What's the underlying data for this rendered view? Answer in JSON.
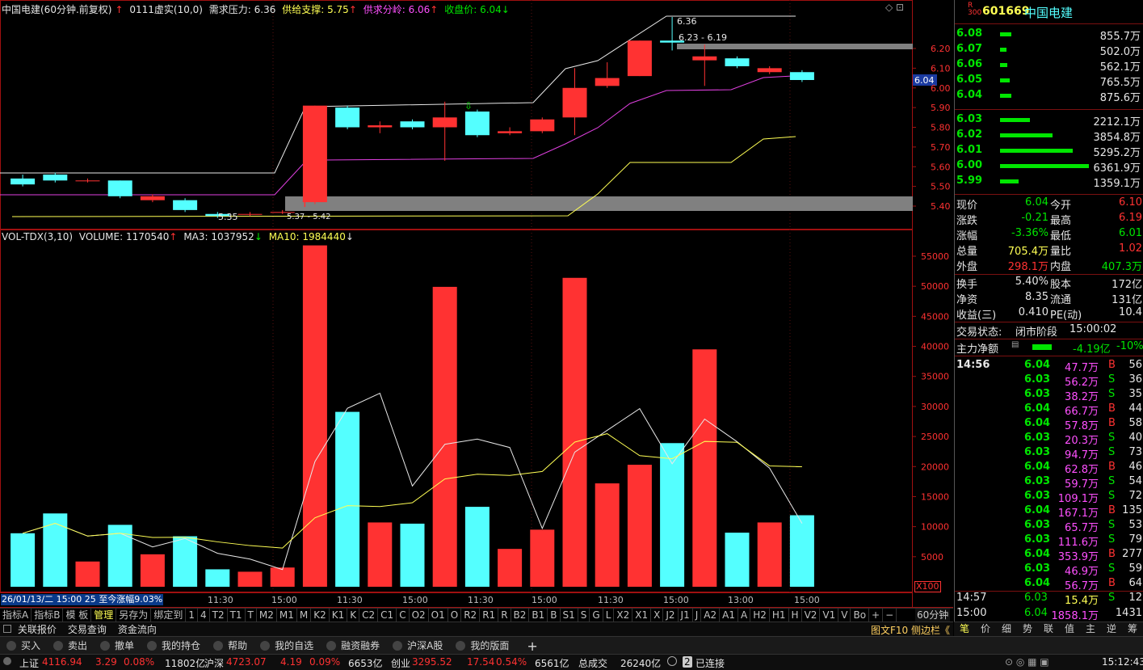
{
  "kline_header": {
    "stock": "中国电建(60分钟.前复权)",
    "ind": "0111虚实(10,0)",
    "demand_label": "需求压力:",
    "demand_value": "6.36",
    "supply_label": "供给支撑:",
    "supply_value": "5.75",
    "split_label": "供求分岭:",
    "split_value": "6.06",
    "close_label": "收盘价:",
    "close_value": "6.04"
  },
  "kline_axis": [
    "6.20",
    "6.10",
    "6.04",
    "6.00",
    "5.90",
    "5.80",
    "5.70",
    "5.60",
    "5.50",
    "5.40"
  ],
  "kline_annotations": {
    "high": "6.36",
    "range": "6.23 - 6.19",
    "low": "5.35",
    "low2": "5.37 - 5.42"
  },
  "vol_header": {
    "name": "VOL-TDX(3,10)",
    "volume": "VOLUME: 1170540",
    "ma3": "MA3: 1037952",
    "ma10": "MA10: 1984440"
  },
  "vol_axis": [
    "55000",
    "50000",
    "45000",
    "40000",
    "35000",
    "30000",
    "25000",
    "20000",
    "15000",
    "10000",
    "5000"
  ],
  "vol_unit": "X100",
  "time_axis": {
    "cursor": "26/01/13/二 15:00 25 至今涨幅9.03%",
    "labels": [
      "11:30",
      "15:00",
      "11:30",
      "15:00",
      "11:30",
      "15:00",
      "11:30",
      "15:00",
      "13:00",
      "15:00"
    ]
  },
  "candles": [
    {
      "o": 5.54,
      "c": 5.51,
      "h": 5.56,
      "l": 5.5
    },
    {
      "o": 5.56,
      "c": 5.53,
      "h": 5.57,
      "l": 5.52
    },
    {
      "o": 5.53,
      "c": 5.53,
      "h": 5.54,
      "l": 5.52
    },
    {
      "o": 5.53,
      "c": 5.45,
      "h": 5.53,
      "l": 5.44
    },
    {
      "o": 5.43,
      "c": 5.45,
      "h": 5.46,
      "l": 5.42
    },
    {
      "o": 5.43,
      "c": 5.38,
      "h": 5.44,
      "l": 5.37
    },
    {
      "o": 5.36,
      "c": 5.35,
      "h": 5.37,
      "l": 5.34
    },
    {
      "o": 5.36,
      "c": 5.36,
      "h": 5.37,
      "l": 5.35
    },
    {
      "o": 5.37,
      "c": 5.37,
      "h": 5.38,
      "l": 5.36
    },
    {
      "o": 5.42,
      "c": 5.91,
      "h": 5.91,
      "l": 5.41
    },
    {
      "o": 5.9,
      "c": 5.8,
      "h": 5.91,
      "l": 5.79
    },
    {
      "o": 5.8,
      "c": 5.81,
      "h": 5.83,
      "l": 5.77
    },
    {
      "o": 5.83,
      "c": 5.8,
      "h": 5.84,
      "l": 5.79
    },
    {
      "o": 5.8,
      "c": 5.85,
      "h": 5.93,
      "l": 5.63
    },
    {
      "o": 5.88,
      "c": 5.76,
      "h": 5.89,
      "l": 5.75
    },
    {
      "o": 5.77,
      "c": 5.78,
      "h": 5.8,
      "l": 5.76
    },
    {
      "o": 5.78,
      "c": 5.84,
      "h": 5.85,
      "l": 5.77
    },
    {
      "o": 5.85,
      "c": 6.0,
      "h": 6.1,
      "l": 5.76
    },
    {
      "o": 6.01,
      "c": 6.05,
      "h": 6.13,
      "l": 6.0
    },
    {
      "o": 6.06,
      "c": 6.24,
      "h": 6.24,
      "l": 6.06
    },
    {
      "o": 6.24,
      "c": 6.23,
      "h": 6.36,
      "l": 6.19
    },
    {
      "o": 6.14,
      "c": 6.16,
      "h": 6.22,
      "l": 6.01
    },
    {
      "o": 6.15,
      "c": 6.11,
      "h": 6.16,
      "l": 6.1
    },
    {
      "o": 6.08,
      "c": 6.1,
      "h": 6.11,
      "l": 6.07
    },
    {
      "o": 6.08,
      "c": 6.04,
      "h": 6.09,
      "l": 6.03
    }
  ],
  "volumes": [
    8900,
    12200,
    4200,
    10300,
    5400,
    8400,
    2900,
    2500,
    3200,
    56800,
    29100,
    10700,
    10500,
    49900,
    13300,
    6300,
    9500,
    51400,
    17200,
    20300,
    23900,
    39500,
    9000,
    10700,
    11900
  ],
  "right": {
    "code": "601669",
    "name": "中国电建",
    "asks": [
      {
        "p": "6.08",
        "v": "855.7万",
        "w": 14
      },
      {
        "p": "6.07",
        "v": "502.0万",
        "w": 8
      },
      {
        "p": "6.06",
        "v": "562.1万",
        "w": 9
      },
      {
        "p": "6.05",
        "v": "765.5万",
        "w": 12
      },
      {
        "p": "6.04",
        "v": "875.6万",
        "w": 14
      }
    ],
    "bids": [
      {
        "p": "6.03",
        "v": "2212.1万",
        "w": 37
      },
      {
        "p": "6.02",
        "v": "3854.8万",
        "w": 65
      },
      {
        "p": "6.01",
        "v": "5295.2万",
        "w": 90
      },
      {
        "p": "6.00",
        "v": "6361.9万",
        "w": 110
      },
      {
        "p": "5.99",
        "v": "1359.1万",
        "w": 23
      }
    ],
    "stats": [
      {
        "l1": "现价",
        "v1": "6.04",
        "c1": "green",
        "l2": "今开",
        "v2": "6.10",
        "c2": "red"
      },
      {
        "l1": "涨跌",
        "v1": "-0.21",
        "c1": "green",
        "l2": "最高",
        "v2": "6.19",
        "c2": "red"
      },
      {
        "l1": "涨幅",
        "v1": "-3.36%",
        "c1": "green",
        "l2": "最低",
        "v2": "6.01",
        "c2": "green"
      },
      {
        "l1": "总量",
        "v1": "705.4万",
        "c1": "yellow",
        "l2": "量比",
        "v2": "1.02",
        "c2": "red"
      },
      {
        "l1": "外盘",
        "v1": "298.1万",
        "c1": "red",
        "l2": "内盘",
        "v2": "407.3万",
        "c2": "green"
      }
    ],
    "stats2": [
      {
        "l1": "换手",
        "v1": "5.40%",
        "l2": "股本",
        "v2": "172亿"
      },
      {
        "l1": "净资",
        "v1": "8.35",
        "l2": "流通",
        "v2": "131亿"
      },
      {
        "l1": "收益(三)",
        "v1": "0.410",
        "l2": "PE(动)",
        "v2": "10.4"
      }
    ],
    "trade_state_label": "交易状态:",
    "trade_state": "闭市阶段",
    "trade_time": "15:00:02",
    "mainflow_label": "主力净额",
    "mainflow_value": "-4.19亿",
    "mainflow_pct": "-10%",
    "ticks_time": "14:56",
    "ticks": [
      {
        "p": "6.04",
        "v": "47.7万",
        "bs": "B",
        "n": "56"
      },
      {
        "p": "6.03",
        "v": "56.2万",
        "bs": "S",
        "n": "36"
      },
      {
        "p": "6.03",
        "v": "38.2万",
        "bs": "S",
        "n": "35"
      },
      {
        "p": "6.04",
        "v": "66.7万",
        "bs": "B",
        "n": "44"
      },
      {
        "p": "6.04",
        "v": "57.8万",
        "bs": "B",
        "n": "58"
      },
      {
        "p": "6.03",
        "v": "20.3万",
        "bs": "S",
        "n": "40"
      },
      {
        "p": "6.03",
        "v": "94.7万",
        "bs": "S",
        "n": "73"
      },
      {
        "p": "6.04",
        "v": "62.8万",
        "bs": "B",
        "n": "46"
      },
      {
        "p": "6.03",
        "v": "59.7万",
        "bs": "S",
        "n": "54"
      },
      {
        "p": "6.03",
        "v": "109.1万",
        "bs": "S",
        "n": "72"
      },
      {
        "p": "6.04",
        "v": "167.1万",
        "bs": "B",
        "n": "135"
      },
      {
        "p": "6.03",
        "v": "65.7万",
        "bs": "S",
        "n": "53"
      },
      {
        "p": "6.03",
        "v": "111.6万",
        "bs": "S",
        "n": "79"
      },
      {
        "p": "6.04",
        "v": "353.9万",
        "bs": "B",
        "n": "277"
      },
      {
        "p": "6.03",
        "v": "46.9万",
        "bs": "S",
        "n": "59"
      },
      {
        "p": "6.04",
        "v": "56.7万",
        "bs": "B",
        "n": "64"
      }
    ],
    "tick_last1": {
      "t": "14:57",
      "p": "6.03",
      "v": "15.4万",
      "bs": "S",
      "n": "12"
    },
    "tick_last2": {
      "t": "15:00",
      "p": "6.04",
      "v": "1858.1万",
      "bs": "",
      "n": "1431"
    },
    "bottom_tabs": [
      "笔",
      "价",
      "细",
      "势",
      "联",
      "值",
      "主",
      "逆",
      "筹"
    ]
  },
  "tabs": [
    "指标A",
    "指标B",
    "模 板",
    "管理",
    "另存为",
    "绑定到",
    "1",
    "4",
    "T2",
    "T1",
    "T",
    "M2",
    "M1",
    "M",
    "K2",
    "K1",
    "K",
    "C2",
    "C1",
    "C",
    "O2",
    "O1",
    "O",
    "R2",
    "R1",
    "R",
    "B2",
    "B1",
    "B",
    "S1",
    "S",
    "G",
    "L",
    "X2",
    "X1",
    "X",
    "J2",
    "J1",
    "J",
    "A2",
    "A1",
    "A",
    "H2",
    "H1",
    "H",
    "V2",
    "V1",
    "V",
    "Bo",
    "+",
    "−"
  ],
  "period": "60分钟",
  "navbar": [
    "关联报价",
    "交易查询",
    "资金流向"
  ],
  "navbar_right": "图文F10 侧边栏《",
  "toolbar": [
    "买入",
    "卖出",
    "撤单",
    "我的持仓",
    "帮助",
    "我的自选",
    "融资融券",
    "沪深A股",
    "我的版面"
  ],
  "status": {
    "sh_label": "上证",
    "sh_val": "4116.94",
    "sh_chg": "3.29",
    "sh_pct": "0.08%",
    "sh_amt": "11802亿",
    "hs_label": "沪深",
    "hs_val": "4723.07",
    "hs_chg": "4.19",
    "hs_pct": "0.09%",
    "hs_amt": "6653亿",
    "cy_label": "创业",
    "cy_val": "3295.52",
    "cy_chg": "17.54",
    "cy_pct": "0.54%",
    "cy_amt": "6561亿",
    "total_label": "总成交",
    "total_val": "26240亿",
    "conn": "已连接",
    "conn_n": "2",
    "time": "15:12:43"
  }
}
